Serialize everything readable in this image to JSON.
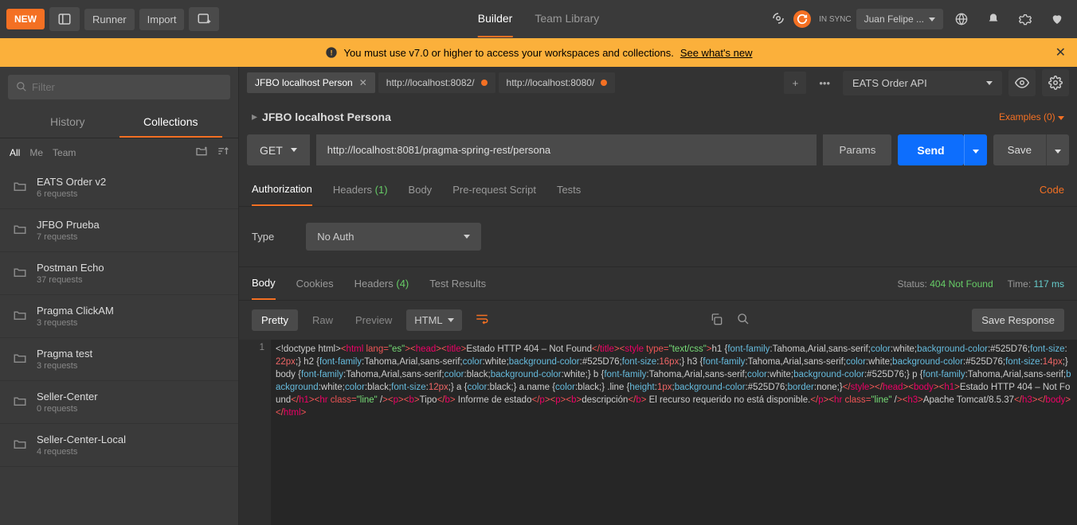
{
  "toolbar": {
    "new_label": "NEW",
    "runner_label": "Runner",
    "import_label": "Import",
    "builder_tab": "Builder",
    "team_tab": "Team Library",
    "sync_status": "IN SYNC",
    "user_label": "Juan Felipe ..."
  },
  "banner": {
    "text": "You must use v7.0 or higher to access your workspaces and collections.",
    "link": "See what's new"
  },
  "sidebar": {
    "filter_placeholder": "Filter",
    "history_tab": "History",
    "collections_tab": "Collections",
    "scope": {
      "all": "All",
      "me": "Me",
      "team": "Team"
    },
    "items": [
      {
        "name": "EATS Order v2",
        "meta": "6 requests"
      },
      {
        "name": "JFBO Prueba",
        "meta": "7 requests"
      },
      {
        "name": "Postman Echo",
        "meta": "37 requests"
      },
      {
        "name": "Pragma ClickAM",
        "meta": "3 requests"
      },
      {
        "name": "Pragma test",
        "meta": "3 requests"
      },
      {
        "name": "Seller-Center",
        "meta": "0 requests"
      },
      {
        "name": "Seller-Center-Local",
        "meta": "4 requests"
      }
    ]
  },
  "tabs": [
    {
      "label": "JFBO localhost Person",
      "active": true,
      "dirty": false
    },
    {
      "label": "http://localhost:8082/",
      "active": false,
      "dirty": true
    },
    {
      "label": "http://localhost:8080/",
      "active": false,
      "dirty": true
    }
  ],
  "env": {
    "selected": "EATS Order API"
  },
  "request": {
    "title": "JFBO localhost Persona",
    "examples_label": "Examples (0)",
    "method": "GET",
    "url": "http://localhost:8081/pragma-spring-rest/persona",
    "params_btn": "Params",
    "send_btn": "Send",
    "save_btn": "Save",
    "sub_tabs": {
      "auth": "Authorization",
      "headers": "Headers",
      "headers_count": "(1)",
      "body": "Body",
      "prereq": "Pre-request Script",
      "tests": "Tests"
    },
    "code_link": "Code",
    "auth": {
      "type_label": "Type",
      "selected": "No Auth"
    }
  },
  "response": {
    "tabs": {
      "body": "Body",
      "cookies": "Cookies",
      "headers": "Headers",
      "headers_count": "(4)",
      "tests": "Test Results"
    },
    "status_label": "Status:",
    "status_value": "404 Not Found",
    "time_label": "Time:",
    "time_value": "117 ms",
    "viewbar": {
      "pretty": "Pretty",
      "raw": "Raw",
      "preview": "Preview",
      "format": "HTML",
      "save_resp": "Save Response"
    },
    "line_no": "1",
    "code_segments": [
      {
        "c": "txt",
        "t": "<!doctype html>"
      },
      {
        "c": "punc",
        "t": "<"
      },
      {
        "c": "tag",
        "t": "html"
      },
      {
        "c": "txt",
        "t": " "
      },
      {
        "c": "attr",
        "t": "lang"
      },
      {
        "c": "punc",
        "t": "="
      },
      {
        "c": "prop",
        "t": "\"es\""
      },
      {
        "c": "punc",
        "t": ">"
      },
      {
        "c": "punc",
        "t": "<"
      },
      {
        "c": "tag",
        "t": "head"
      },
      {
        "c": "punc",
        "t": ">"
      },
      {
        "c": "punc",
        "t": "<"
      },
      {
        "c": "tag",
        "t": "title"
      },
      {
        "c": "punc",
        "t": ">"
      },
      {
        "c": "txt",
        "t": "Estado HTTP 404 – Not Found"
      },
      {
        "c": "punc",
        "t": "</"
      },
      {
        "c": "tag",
        "t": "title"
      },
      {
        "c": "punc",
        "t": ">"
      },
      {
        "c": "punc",
        "t": "<"
      },
      {
        "c": "tag",
        "t": "style"
      },
      {
        "c": "txt",
        "t": " "
      },
      {
        "c": "attr",
        "t": "type"
      },
      {
        "c": "punc",
        "t": "="
      },
      {
        "c": "prop",
        "t": "\"text/css\""
      },
      {
        "c": "punc",
        "t": ">"
      },
      {
        "c": "txt",
        "t": "h1 {"
      },
      {
        "c": "key",
        "t": "font-family"
      },
      {
        "c": "txt",
        "t": ":Tahoma,Arial,sans-serif;"
      },
      {
        "c": "key",
        "t": "color"
      },
      {
        "c": "txt",
        "t": ":white;"
      },
      {
        "c": "key",
        "t": "background-color"
      },
      {
        "c": "txt",
        "t": ":#525D76;"
      },
      {
        "c": "key",
        "t": "font-size"
      },
      {
        "c": "txt",
        "t": ":"
      },
      {
        "c": "num",
        "t": "22px"
      },
      {
        "c": "txt",
        "t": ";} h2 {"
      },
      {
        "c": "key",
        "t": "font-family"
      },
      {
        "c": "txt",
        "t": ":Tahoma,Arial,sans-serif;"
      },
      {
        "c": "key",
        "t": "color"
      },
      {
        "c": "txt",
        "t": ":white;"
      },
      {
        "c": "key",
        "t": "background-color"
      },
      {
        "c": "txt",
        "t": ":#525D76;"
      },
      {
        "c": "key",
        "t": "font-size"
      },
      {
        "c": "txt",
        "t": ":"
      },
      {
        "c": "num",
        "t": "16px"
      },
      {
        "c": "txt",
        "t": ";} h3 {"
      },
      {
        "c": "key",
        "t": "font-family"
      },
      {
        "c": "txt",
        "t": ":Tahoma,Arial,sans-serif;"
      },
      {
        "c": "key",
        "t": "color"
      },
      {
        "c": "txt",
        "t": ":white;"
      },
      {
        "c": "key",
        "t": "background-color"
      },
      {
        "c": "txt",
        "t": ":#525D76;"
      },
      {
        "c": "key",
        "t": "font-size"
      },
      {
        "c": "txt",
        "t": ":"
      },
      {
        "c": "num",
        "t": "14px"
      },
      {
        "c": "txt",
        "t": ";} body {"
      },
      {
        "c": "key",
        "t": "font-family"
      },
      {
        "c": "txt",
        "t": ":Tahoma,Arial,sans-serif;"
      },
      {
        "c": "key",
        "t": "color"
      },
      {
        "c": "txt",
        "t": ":black;"
      },
      {
        "c": "key",
        "t": "background-color"
      },
      {
        "c": "txt",
        "t": ":white;} b {"
      },
      {
        "c": "key",
        "t": "font-family"
      },
      {
        "c": "txt",
        "t": ":Tahoma,Arial,sans-serif;"
      },
      {
        "c": "key",
        "t": "color"
      },
      {
        "c": "txt",
        "t": ":white;"
      },
      {
        "c": "key",
        "t": "background-color"
      },
      {
        "c": "txt",
        "t": ":#525D76;} p {"
      },
      {
        "c": "key",
        "t": "font-family"
      },
      {
        "c": "txt",
        "t": ":Tahoma,Arial,sans-serif;"
      },
      {
        "c": "key",
        "t": "background"
      },
      {
        "c": "txt",
        "t": ":white;"
      },
      {
        "c": "key",
        "t": "color"
      },
      {
        "c": "txt",
        "t": ":black;"
      },
      {
        "c": "key",
        "t": "font-size"
      },
      {
        "c": "txt",
        "t": ":"
      },
      {
        "c": "num",
        "t": "12px"
      },
      {
        "c": "txt",
        "t": ";} a {"
      },
      {
        "c": "key",
        "t": "color"
      },
      {
        "c": "txt",
        "t": ":black;} a.name {"
      },
      {
        "c": "key",
        "t": "color"
      },
      {
        "c": "txt",
        "t": ":black;} .line {"
      },
      {
        "c": "key",
        "t": "height"
      },
      {
        "c": "txt",
        "t": ":"
      },
      {
        "c": "num",
        "t": "1px"
      },
      {
        "c": "txt",
        "t": ";"
      },
      {
        "c": "key",
        "t": "background-color"
      },
      {
        "c": "txt",
        "t": ":#525D76;"
      },
      {
        "c": "key",
        "t": "border"
      },
      {
        "c": "txt",
        "t": ":none;}"
      },
      {
        "c": "punc",
        "t": "</"
      },
      {
        "c": "tag",
        "t": "style"
      },
      {
        "c": "punc",
        "t": ">"
      },
      {
        "c": "punc",
        "t": "</"
      },
      {
        "c": "tag",
        "t": "head"
      },
      {
        "c": "punc",
        "t": ">"
      },
      {
        "c": "punc",
        "t": "<"
      },
      {
        "c": "tag",
        "t": "body"
      },
      {
        "c": "punc",
        "t": ">"
      },
      {
        "c": "punc",
        "t": "<"
      },
      {
        "c": "tag",
        "t": "h1"
      },
      {
        "c": "punc",
        "t": ">"
      },
      {
        "c": "txt",
        "t": "Estado HTTP 404 – Not Found"
      },
      {
        "c": "punc",
        "t": "</"
      },
      {
        "c": "tag",
        "t": "h1"
      },
      {
        "c": "punc",
        "t": ">"
      },
      {
        "c": "punc",
        "t": "<"
      },
      {
        "c": "tag",
        "t": "hr"
      },
      {
        "c": "txt",
        "t": " "
      },
      {
        "c": "attr",
        "t": "class"
      },
      {
        "c": "punc",
        "t": "="
      },
      {
        "c": "prop",
        "t": "\"line\""
      },
      {
        "c": "txt",
        "t": " /"
      },
      {
        "c": "punc",
        "t": ">"
      },
      {
        "c": "punc",
        "t": "<"
      },
      {
        "c": "tag",
        "t": "p"
      },
      {
        "c": "punc",
        "t": ">"
      },
      {
        "c": "punc",
        "t": "<"
      },
      {
        "c": "tag",
        "t": "b"
      },
      {
        "c": "punc",
        "t": ">"
      },
      {
        "c": "txt",
        "t": "Tipo"
      },
      {
        "c": "punc",
        "t": "</"
      },
      {
        "c": "tag",
        "t": "b"
      },
      {
        "c": "punc",
        "t": ">"
      },
      {
        "c": "txt",
        "t": " Informe de estado"
      },
      {
        "c": "punc",
        "t": "</"
      },
      {
        "c": "tag",
        "t": "p"
      },
      {
        "c": "punc",
        "t": ">"
      },
      {
        "c": "punc",
        "t": "<"
      },
      {
        "c": "tag",
        "t": "p"
      },
      {
        "c": "punc",
        "t": ">"
      },
      {
        "c": "punc",
        "t": "<"
      },
      {
        "c": "tag",
        "t": "b"
      },
      {
        "c": "punc",
        "t": ">"
      },
      {
        "c": "txt",
        "t": "descripción"
      },
      {
        "c": "punc",
        "t": "</"
      },
      {
        "c": "tag",
        "t": "b"
      },
      {
        "c": "punc",
        "t": ">"
      },
      {
        "c": "txt",
        "t": " El recurso requerido no está disponible."
      },
      {
        "c": "punc",
        "t": "</"
      },
      {
        "c": "tag",
        "t": "p"
      },
      {
        "c": "punc",
        "t": ">"
      },
      {
        "c": "punc",
        "t": "<"
      },
      {
        "c": "tag",
        "t": "hr"
      },
      {
        "c": "txt",
        "t": " "
      },
      {
        "c": "attr",
        "t": "class"
      },
      {
        "c": "punc",
        "t": "="
      },
      {
        "c": "prop",
        "t": "\"line\""
      },
      {
        "c": "txt",
        "t": " /"
      },
      {
        "c": "punc",
        "t": ">"
      },
      {
        "c": "punc",
        "t": "<"
      },
      {
        "c": "tag",
        "t": "h3"
      },
      {
        "c": "punc",
        "t": ">"
      },
      {
        "c": "txt",
        "t": "Apache Tomcat/8.5.37"
      },
      {
        "c": "punc",
        "t": "</"
      },
      {
        "c": "tag",
        "t": "h3"
      },
      {
        "c": "punc",
        "t": ">"
      },
      {
        "c": "punc",
        "t": "</"
      },
      {
        "c": "tag",
        "t": "body"
      },
      {
        "c": "punc",
        "t": ">"
      },
      {
        "c": "punc",
        "t": "</"
      },
      {
        "c": "tag",
        "t": "html"
      },
      {
        "c": "punc",
        "t": ">"
      }
    ]
  }
}
